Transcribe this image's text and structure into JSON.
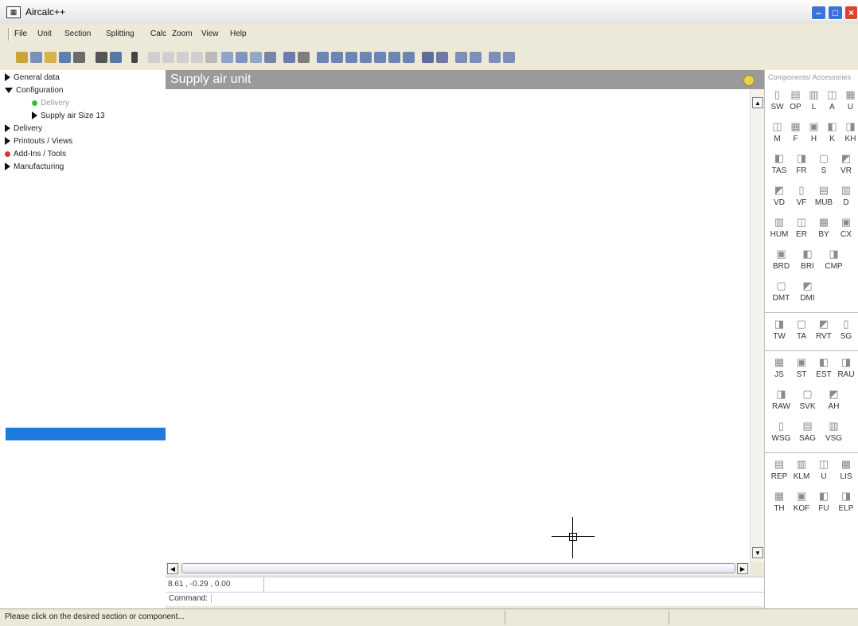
{
  "window": {
    "title": "Aircalc++",
    "icon": "app-icon"
  },
  "menu": [
    "File",
    "Unit",
    "Section",
    "Splitting",
    "Calc",
    "Zoom",
    "View",
    "Help"
  ],
  "tree": {
    "items": [
      {
        "label": "General data",
        "marker": "triangle-right"
      },
      {
        "label": "Configuration",
        "marker": "triangle-down"
      },
      {
        "label": "Delivery",
        "marker": "green-dot",
        "dim": true
      },
      {
        "label": "Supply air Size 13",
        "marker": "triangle-right"
      },
      {
        "label": "Delivery",
        "marker": "triangle-right"
      },
      {
        "label": "Printouts / Views",
        "marker": "triangle-right"
      },
      {
        "label": "Add-Ins / Tools",
        "marker": "red-dot"
      },
      {
        "label": "Manufacturing",
        "marker": "triangle-right"
      }
    ]
  },
  "canvas": {
    "title": "Supply air unit"
  },
  "coords": "8.61 , -0.29 , 0.00",
  "command_label": "Command:",
  "status": "Please click on the desired section or component...",
  "panel": {
    "title": "Components/ Accessories",
    "groups": [
      [
        [
          "SW",
          "OP",
          "L",
          "A",
          "U"
        ],
        [
          "M",
          "F",
          "H",
          "K",
          "KH"
        ],
        [
          "TAS",
          "FR",
          "S",
          "VR"
        ],
        [
          "VD",
          "VF",
          "MUB",
          "D"
        ],
        [
          "HUM",
          "ER",
          "BY",
          "CX"
        ],
        [
          "BRD",
          "BRI",
          "CMP"
        ],
        [
          "DMT",
          "DMI"
        ]
      ],
      [
        [
          "TW",
          "TA",
          "RVT",
          "SG"
        ]
      ],
      [
        [
          "JS",
          "ST",
          "EST",
          "RAU"
        ],
        [
          "RAW",
          "SVK",
          "AH"
        ],
        [
          "WSG",
          "SAG",
          "VSG"
        ]
      ],
      [
        [
          "REP",
          "KLM",
          "U",
          "LIS"
        ],
        [
          "TH",
          "KOF",
          "FU",
          "ELP"
        ]
      ]
    ]
  },
  "colors": {
    "selection": "#1e7bdc",
    "header": "#9a9a9a",
    "close": "#d9442a"
  }
}
